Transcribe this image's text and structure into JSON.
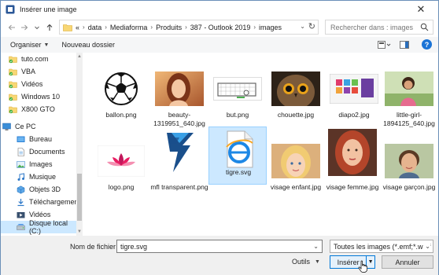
{
  "window": {
    "title": "Insérer une image",
    "close_glyph": "✕"
  },
  "address": {
    "prefix": "«",
    "crumbs": [
      "data",
      "Mediaforma",
      "Produits",
      "387 - Outlook 2019",
      "images"
    ]
  },
  "search": {
    "placeholder": "Rechercher dans : images"
  },
  "toolbar": {
    "organize_label": "Organiser",
    "new_folder_label": "Nouveau dossier",
    "help_glyph": "?"
  },
  "nav": {
    "items": [
      {
        "label": "tuto.com",
        "icon": "onedrive-folder-icon"
      },
      {
        "label": "VBA",
        "icon": "onedrive-folder-icon"
      },
      {
        "label": "Vidéos",
        "icon": "onedrive-folder-icon"
      },
      {
        "label": "Windows 10",
        "icon": "onedrive-folder-icon"
      },
      {
        "label": "X800 GTO",
        "icon": "onedrive-folder-icon"
      },
      {
        "label": "Ce PC",
        "icon": "computer-icon"
      },
      {
        "label": "Bureau",
        "icon": "desktop-icon"
      },
      {
        "label": "Documents",
        "icon": "documents-icon"
      },
      {
        "label": "Images",
        "icon": "pictures-icon"
      },
      {
        "label": "Musique",
        "icon": "music-icon"
      },
      {
        "label": "Objets 3D",
        "icon": "3d-objects-icon"
      },
      {
        "label": "Téléchargement",
        "icon": "downloads-icon"
      },
      {
        "label": "Vidéos",
        "icon": "videos-icon"
      },
      {
        "label": "Disque local (C:)",
        "icon": "drive-icon"
      }
    ]
  },
  "files": [
    {
      "label": "ballon.png",
      "icon": "soccer-ball-thumbnail"
    },
    {
      "label": "beauty-1319951_640.jpg",
      "icon": "portrait-thumbnail"
    },
    {
      "label": "but.png",
      "icon": "goal-thumbnail"
    },
    {
      "label": "chouette.jpg",
      "icon": "owl-thumbnail"
    },
    {
      "label": "diapo2.jpg",
      "icon": "slide-thumbnail"
    },
    {
      "label": "little-girl-1894125_640.jpg",
      "icon": "girl-thumbnail"
    },
    {
      "label": "logo.png",
      "icon": "lotus-logo-thumbnail"
    },
    {
      "label": "mfl transparent.png",
      "icon": "mfl-logo-thumbnail"
    },
    {
      "label": "tigre.svg",
      "icon": "svg-file-thumbnail"
    },
    {
      "label": "visage enfant.jpg",
      "icon": "child-face-thumbnail"
    },
    {
      "label": "visage femme.jpg",
      "icon": "woman-face-thumbnail"
    },
    {
      "label": "visage garçon.jpg",
      "icon": "boy-face-thumbnail"
    }
  ],
  "bottom": {
    "filename_label": "Nom de fichier :",
    "filename_value": "tigre.svg",
    "filetype_value": "Toutes les images (*.emf;*.wmf",
    "tools_label": "Outils",
    "insert_label": "Insérer",
    "cancel_label": "Annuler"
  },
  "colors": {
    "selection": "#cce8ff",
    "accent": "#0078d7"
  }
}
